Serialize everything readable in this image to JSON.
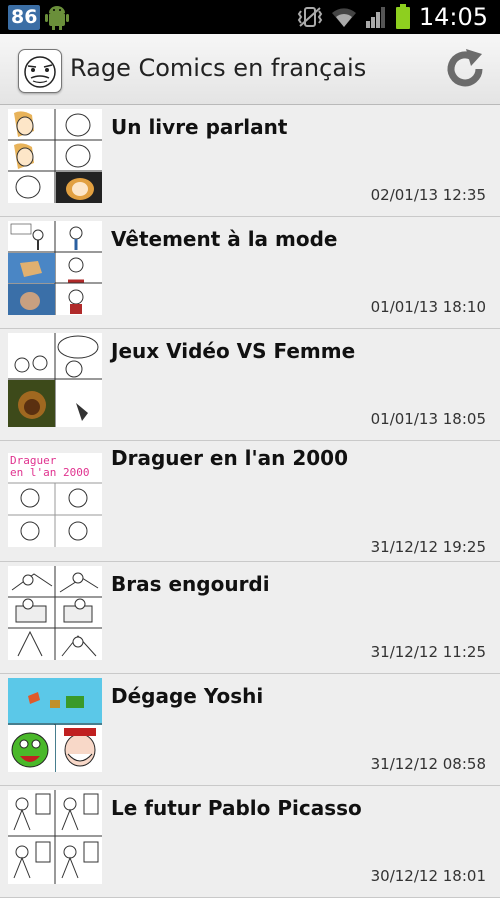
{
  "status_bar": {
    "notification_count": "86",
    "time": "14:05",
    "icons": [
      "android-icon",
      "vibrate-icon",
      "wifi-icon",
      "signal-icon",
      "battery-icon"
    ]
  },
  "app_bar": {
    "title": "Rage Comics en français",
    "app_icon": "rage-face-icon",
    "refresh_icon": "refresh-icon"
  },
  "comics": [
    {
      "title": "Un livre parlant",
      "date": "02/01/13 12:35"
    },
    {
      "title": "Vêtement à la mode",
      "date": "01/01/13 18:10"
    },
    {
      "title": "Jeux Vidéo VS Femme",
      "date": "01/01/13 18:05"
    },
    {
      "title": "Draguer en l'an 2000",
      "date": "31/12/12 19:25",
      "thumb_text": "Draguer\nen l'an 2000"
    },
    {
      "title": "Bras engourdi",
      "date": "31/12/12 11:25"
    },
    {
      "title": "Dégage Yoshi",
      "date": "31/12/12 08:58"
    },
    {
      "title": "Le futur Pablo Picasso",
      "date": "30/12/12 18:01"
    }
  ],
  "colors": {
    "status_bar_bg": "#000000",
    "notification_badge": "#3b6ea5",
    "battery": "#8ecf1f",
    "list_bg": "#eeeeee",
    "thumb_draguer_text": "#e0338f"
  }
}
